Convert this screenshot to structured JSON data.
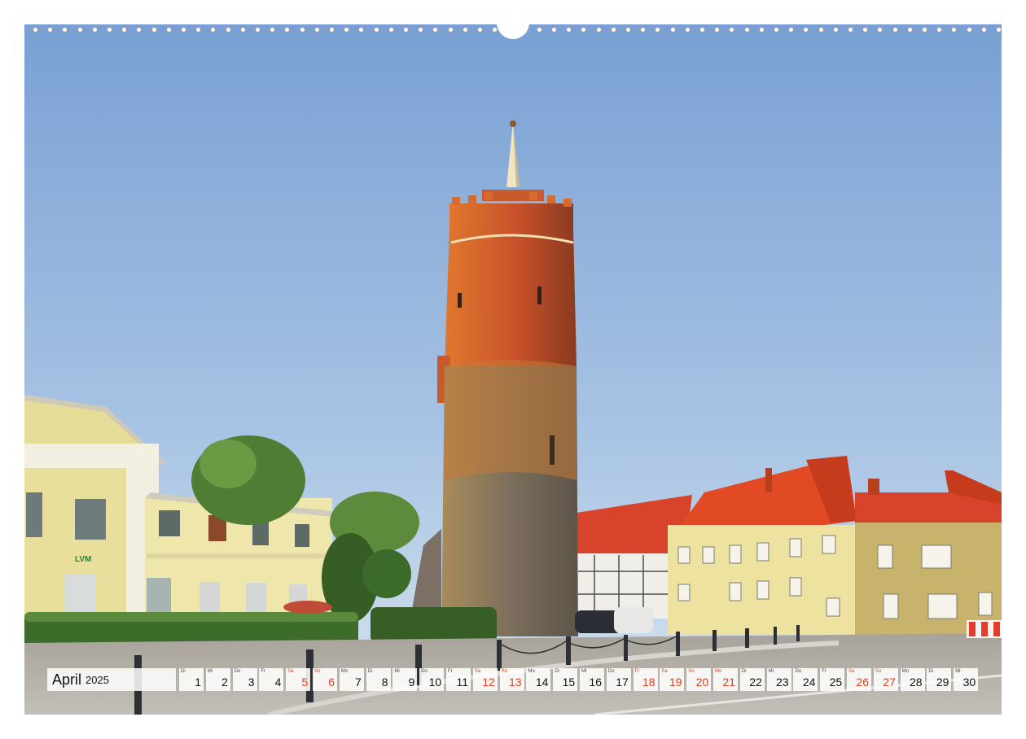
{
  "calendar": {
    "month": "April",
    "year": "2025",
    "days": [
      {
        "wd": "Di",
        "num": "1",
        "weekend": false
      },
      {
        "wd": "Mi",
        "num": "2",
        "weekend": false
      },
      {
        "wd": "Do",
        "num": "3",
        "weekend": false
      },
      {
        "wd": "Fr",
        "num": "4",
        "weekend": false
      },
      {
        "wd": "Sa",
        "num": "5",
        "weekend": true
      },
      {
        "wd": "So",
        "num": "6",
        "weekend": true
      },
      {
        "wd": "Mo",
        "num": "7",
        "weekend": false
      },
      {
        "wd": "Di",
        "num": "8",
        "weekend": false
      },
      {
        "wd": "Mi",
        "num": "9",
        "weekend": false
      },
      {
        "wd": "Do",
        "num": "10",
        "weekend": false
      },
      {
        "wd": "Fr",
        "num": "11",
        "weekend": false
      },
      {
        "wd": "Sa",
        "num": "12",
        "weekend": true
      },
      {
        "wd": "So",
        "num": "13",
        "weekend": true
      },
      {
        "wd": "Mo",
        "num": "14",
        "weekend": false
      },
      {
        "wd": "Di",
        "num": "15",
        "weekend": false
      },
      {
        "wd": "Mi",
        "num": "16",
        "weekend": false
      },
      {
        "wd": "Do",
        "num": "17",
        "weekend": false
      },
      {
        "wd": "Fr",
        "num": "18",
        "weekend": true
      },
      {
        "wd": "Sa",
        "num": "19",
        "weekend": true
      },
      {
        "wd": "So",
        "num": "20",
        "weekend": true
      },
      {
        "wd": "Mo",
        "num": "21",
        "weekend": true
      },
      {
        "wd": "Di",
        "num": "22",
        "weekend": false
      },
      {
        "wd": "Mi",
        "num": "23",
        "weekend": false
      },
      {
        "wd": "Do",
        "num": "24",
        "weekend": false
      },
      {
        "wd": "Fr",
        "num": "25",
        "weekend": false
      },
      {
        "wd": "Sa",
        "num": "26",
        "weekend": true
      },
      {
        "wd": "So",
        "num": "27",
        "weekend": true
      },
      {
        "wd": "Mo",
        "num": "28",
        "weekend": false
      },
      {
        "wd": "Di",
        "num": "29",
        "weekend": false
      },
      {
        "wd": "Mi",
        "num": "30",
        "weekend": false
      }
    ]
  },
  "photo": {
    "sign_text": "LVM",
    "colors": {
      "sky_top": "#7aa0d4",
      "sky_bottom": "#cfe0ee",
      "brick": "#c9542a",
      "stone": "#8a7b66",
      "roof": "#d8401f",
      "facade": "#e9df9a",
      "hedge": "#3f6b2a",
      "pavement": "#a9a69f"
    }
  }
}
